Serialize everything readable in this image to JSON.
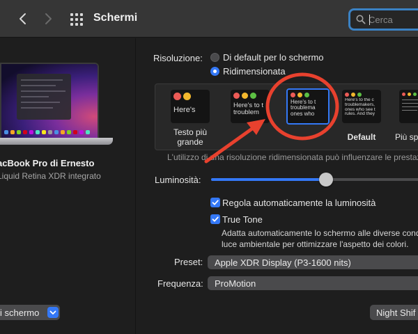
{
  "toolbar": {
    "title": "Schermi",
    "search_placeholder": "Cerca",
    "back_icon": "chevron-left-icon",
    "forward_icon": "chevron-right-icon",
    "grid_icon": "grid-icon",
    "search_icon": "magnifier-icon"
  },
  "sidebar": {
    "device_name": "acBook Pro di Ernesto",
    "device_subtitle": "Liquid Retina XDR integrato",
    "display_settings_label": "i schermo"
  },
  "resolution": {
    "label": "Risoluzione:",
    "options": [
      {
        "label": "Di default per lo schermo",
        "selected": false
      },
      {
        "label": "Ridimensionata",
        "selected": true
      }
    ]
  },
  "scale_options": [
    {
      "sample_text": "Here's",
      "label": "Testo più grande",
      "selected": false
    },
    {
      "sample_text": "Here's to t troublem",
      "label": "",
      "selected": false
    },
    {
      "sample_text": "Here's to t troublema ones who",
      "label": "",
      "selected": true
    },
    {
      "sample_text": "Here's to the c troublemakers, ones who see t rules. And they",
      "label": "Default",
      "selected": false
    },
    {
      "sample_text": "",
      "label": "Più sp",
      "selected": false
    }
  ],
  "scale_note": "L'utilizzo di una risoluzione ridimensionata può influenzare le prestaz",
  "brightness": {
    "label": "Luminosità:",
    "level": 0.55
  },
  "auto_brightness": {
    "label": "Regola automaticamente la luminosità",
    "checked": true
  },
  "true_tone": {
    "label": "True Tone",
    "checked": true,
    "description_line1": "Adatta automaticamente lo schermo alle diverse cond",
    "description_line2": "luce ambientale per ottimizzare l'aspetto dei colori."
  },
  "preset": {
    "label": "Preset:",
    "value": "Apple XDR Display (P3-1600 nits)"
  },
  "refresh_rate": {
    "label": "Frequenza:",
    "value": "ProMotion"
  },
  "night_shift_label": "Night Shif",
  "colors": {
    "accent": "#3478f6",
    "annotation": "#e8412e",
    "traffic_red": "#ec5b56",
    "traffic_yellow": "#f2b72d",
    "traffic_green": "#5cc043"
  }
}
